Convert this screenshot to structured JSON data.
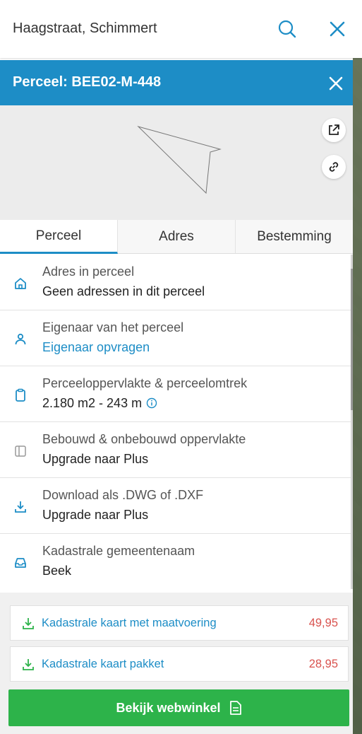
{
  "search": {
    "value": "Haagstraat, Schimmert"
  },
  "header": {
    "title": "Perceel: BEE02-M-448"
  },
  "tabs": [
    {
      "label": "Perceel",
      "active": true
    },
    {
      "label": "Adres",
      "active": false
    },
    {
      "label": "Bestemming",
      "active": false
    }
  ],
  "rows": [
    {
      "icon": "house-icon",
      "title": "Adres in perceel",
      "value": "Geen adressen in dit perceel"
    },
    {
      "icon": "person-icon",
      "title": "Eigenaar van het perceel",
      "value": "Eigenaar opvragen"
    },
    {
      "icon": "clipboard-icon",
      "title": "Perceeloppervlakte & perceelomtrek",
      "value": "2.180 m2 - 243 m"
    },
    {
      "icon": "panel-icon",
      "title": "Bebouwd & onbebouwd oppervlakte",
      "value": "Upgrade naar Plus"
    },
    {
      "icon": "download-icon",
      "title": "Download als .DWG of .DXF",
      "value": "Upgrade naar Plus"
    },
    {
      "icon": "inbox-icon",
      "title": "Kadastrale gemeentenaam",
      "value": "Beek"
    }
  ],
  "products": [
    {
      "label": "Kadastrale kaart met maatvoering",
      "price": "49,95"
    },
    {
      "label": "Kadastrale kaart pakket",
      "price": "28,95"
    }
  ],
  "shop_button": {
    "label": "Bekijk webwinkel"
  },
  "colors": {
    "accent": "#1d8dc6",
    "price": "#d9534f",
    "shop": "#2db34a"
  }
}
